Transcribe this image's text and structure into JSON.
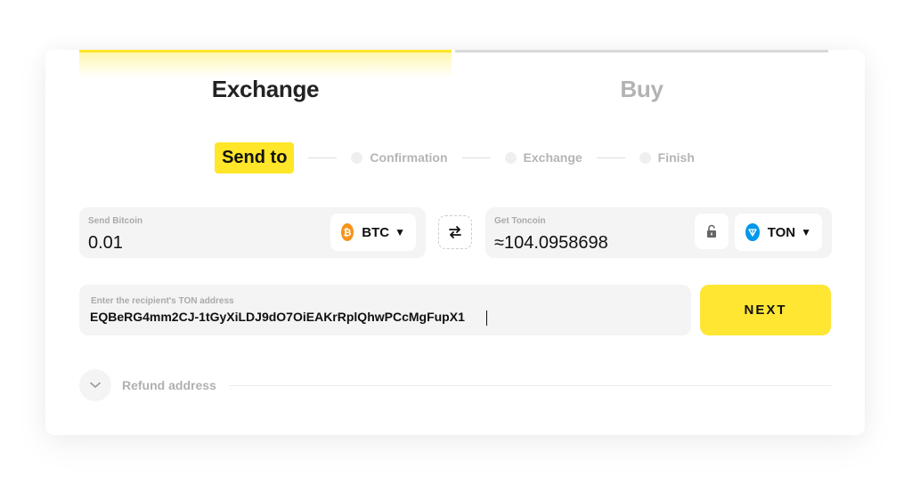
{
  "tabs": [
    {
      "label": "Exchange",
      "active": true
    },
    {
      "label": "Buy",
      "active": false
    }
  ],
  "stepper": {
    "steps": [
      {
        "label": "Send to",
        "active": true
      },
      {
        "label": "Confirmation",
        "active": false
      },
      {
        "label": "Exchange",
        "active": false
      },
      {
        "label": "Finish",
        "active": false
      }
    ]
  },
  "send": {
    "label": "Send Bitcoin",
    "value": "0.01",
    "coin": {
      "ticker": "BTC",
      "icon": "bitcoin-icon",
      "color": "#f7931a",
      "caret": "▼"
    }
  },
  "swap": {
    "icon": "swap-arrows-icon"
  },
  "get": {
    "label": "Get Toncoin",
    "value": "≈104.0958698",
    "lock_icon": "unlocked-padlock-icon",
    "coin": {
      "ticker": "TON",
      "icon": "toncoin-icon",
      "color": "#0098ea",
      "caret": "▼"
    }
  },
  "address": {
    "label": "Enter the recipient's TON address",
    "value": "EQBeRG4mm2CJ-1tGyXiLDJ9dO7OiEAKrRplQhwPCcMgFupX1"
  },
  "next_button": {
    "label": "NEXT"
  },
  "refund": {
    "label": "Refund address",
    "icon": "chevron-down-icon"
  },
  "colors": {
    "accent": "#ffe629",
    "field_bg": "#f4f4f4",
    "muted_text": "#b3b3b3"
  }
}
